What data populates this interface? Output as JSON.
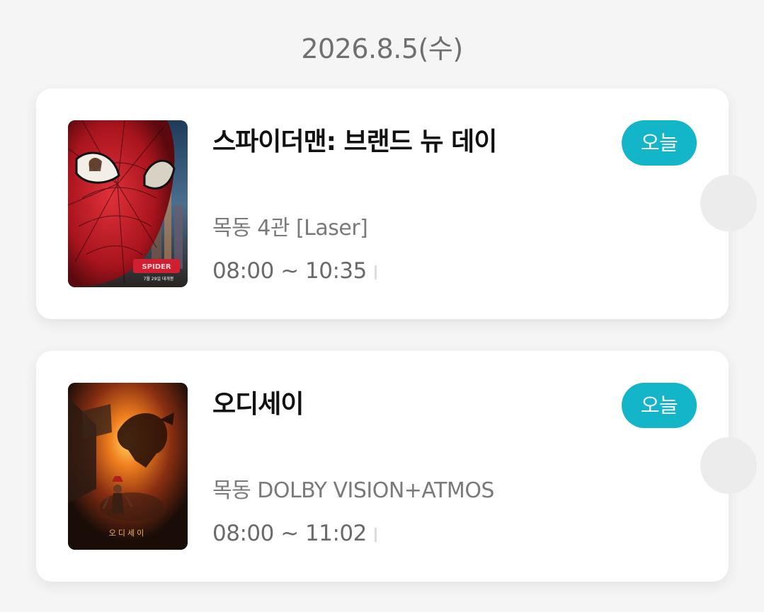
{
  "date": "2026.8.5(수)",
  "tickets": [
    {
      "title": "스파이더맨: 브랜드 뉴 데이",
      "badge": "오늘",
      "theater": "목동 4관 [Laser]",
      "showtime": "08:00 ~ 10:35",
      "poster_icon": "spiderman-poster-image",
      "poster_text": "7월 29일 대개봉"
    },
    {
      "title": "오디세이",
      "badge": "오늘",
      "theater": "목동 DOLBY VISION+ATMOS",
      "showtime": "08:00 ~ 11:02",
      "poster_icon": "odyssey-poster-image",
      "poster_text": "오디세이"
    }
  ],
  "colors": {
    "background": "#f5f5f5",
    "card": "#ffffff",
    "badge": "#13b5c8",
    "title": "#111111",
    "meta": "#7a7a7a"
  }
}
